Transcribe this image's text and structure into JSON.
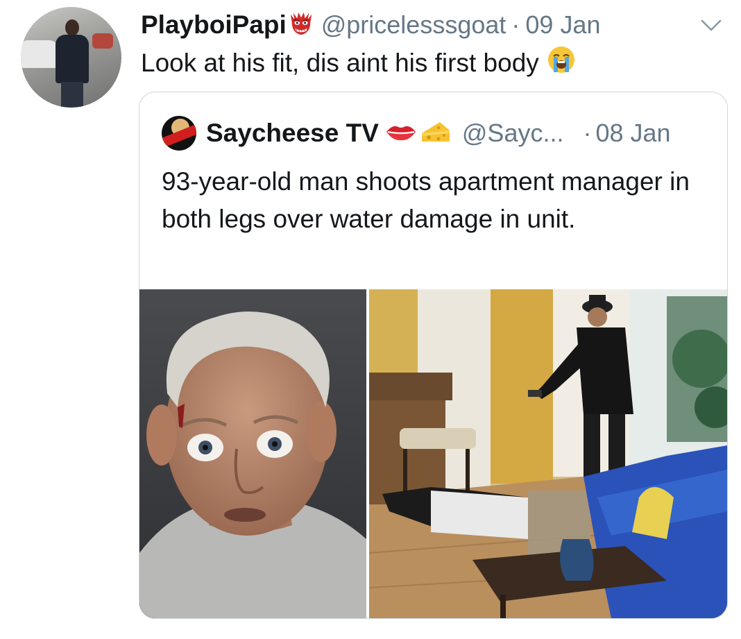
{
  "tweet": {
    "display_name": "PlayboiPapi",
    "name_emoji": "ogre-emoji",
    "handle": "@pricelesssgoat",
    "separator": "·",
    "date": "09 Jan",
    "text": "Look at his fit, dis aint his first body",
    "text_emoji": "loudly-crying-face-emoji",
    "menu_icon": "chevron-down-icon"
  },
  "quoted_tweet": {
    "display_name": "Saycheese TV",
    "name_emojis": [
      "lips-emoji",
      "cheese-emoji"
    ],
    "handle": "@Sayc...",
    "separator": "·",
    "date": "08 Jan",
    "text": "93-year-old man shoots apartment manager in both legs over water damage in unit.",
    "media": [
      {
        "description_icon": "mugshot-photo"
      },
      {
        "description_icon": "surveillance-photo"
      }
    ]
  },
  "colors": {
    "primary_text": "#14171a",
    "secondary_text": "#657786",
    "card_border": "#ccd6dd",
    "background": "#ffffff"
  }
}
